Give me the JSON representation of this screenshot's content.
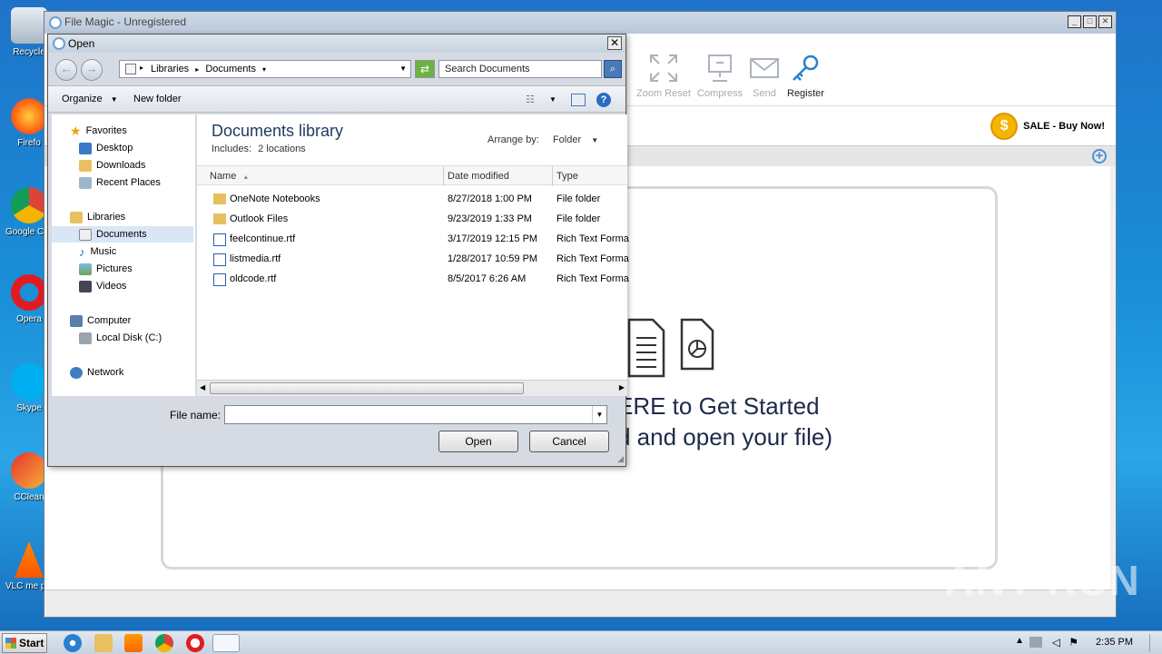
{
  "desktop": {
    "icons": [
      "Recycle",
      "Firefo",
      "Google Chrom",
      "Opera",
      "Skype",
      "CClean",
      "VLC me playe"
    ]
  },
  "app": {
    "title": "File Magic - Unregistered",
    "toolbar": {
      "zoom_reset": "Zoom Reset",
      "compress": "Compress",
      "send": "Send",
      "register": "Register"
    },
    "sale": "SALE - Buy Now!",
    "dropzone": {
      "line1": "ERE to Get Started",
      "line2": "d and open your file)"
    }
  },
  "dialog": {
    "title": "Open",
    "address": {
      "segment1": "Libraries",
      "segment2": "Documents"
    },
    "search_placeholder": "Search Documents",
    "commands": {
      "organize": "Organize",
      "new_folder": "New folder"
    },
    "nav": {
      "favorites": "Favorites",
      "desktop": "Desktop",
      "downloads": "Downloads",
      "recent": "Recent Places",
      "libraries": "Libraries",
      "documents": "Documents",
      "music": "Music",
      "pictures": "Pictures",
      "videos": "Videos",
      "computer": "Computer",
      "local_disk": "Local Disk (C:)",
      "network": "Network"
    },
    "library": {
      "title": "Documents library",
      "includes": "Includes:",
      "locations": "2 locations",
      "arrange_by": "Arrange by:",
      "arrange_value": "Folder"
    },
    "columns": {
      "name": "Name",
      "date": "Date modified",
      "type": "Type"
    },
    "files": [
      {
        "name": "OneNote Notebooks",
        "date": "8/27/2018 1:00 PM",
        "type": "File folder"
      },
      {
        "name": "Outlook Files",
        "date": "9/23/2019 1:33 PM",
        "type": "File folder"
      },
      {
        "name": "feelcontinue.rtf",
        "date": "3/17/2019 12:15 PM",
        "type": "Rich Text Forma"
      },
      {
        "name": "listmedia.rtf",
        "date": "1/28/2017 10:59 PM",
        "type": "Rich Text Forma"
      },
      {
        "name": "oldcode.rtf",
        "date": "8/5/2017 6:26 AM",
        "type": "Rich Text Forma"
      }
    ],
    "filename_label": "File name:",
    "filename_value": "",
    "open": "Open",
    "cancel": "Cancel"
  },
  "taskbar": {
    "start": "Start",
    "clock": "2:35 PM"
  },
  "watermark": "ANY RUN"
}
